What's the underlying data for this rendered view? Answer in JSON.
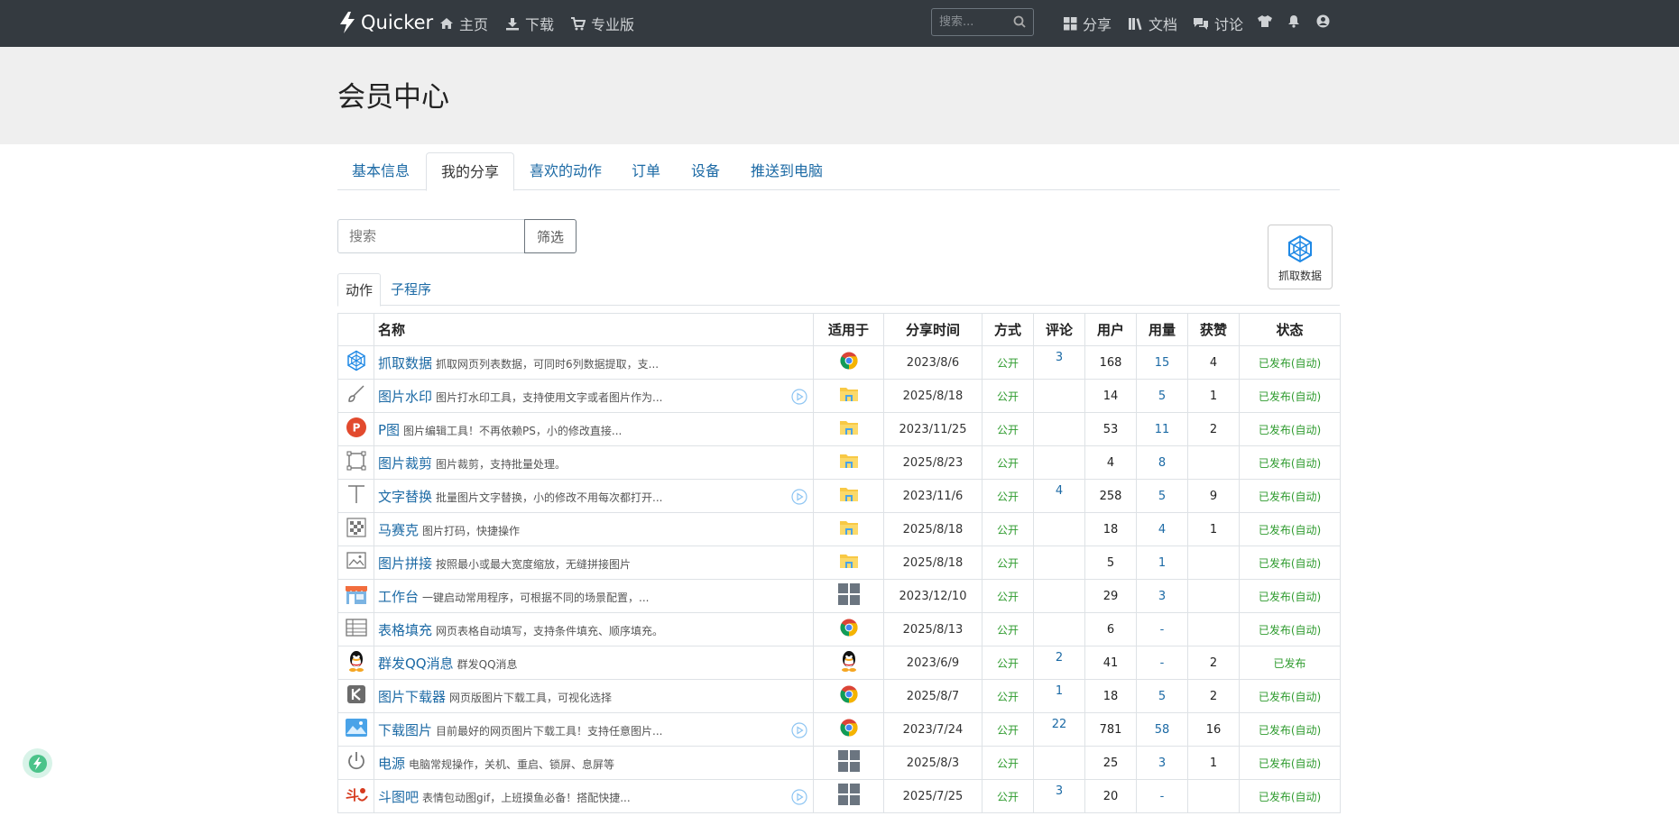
{
  "nav": {
    "brand": "Quicker",
    "links": [
      {
        "label": "主页",
        "icon": "home-icon"
      },
      {
        "label": "下载",
        "icon": "download-icon"
      },
      {
        "label": "专业版",
        "icon": "cart-icon"
      }
    ],
    "search_placeholder": "搜索...",
    "right_links": [
      {
        "label": "分享",
        "icon": "grid-icon"
      },
      {
        "label": "文档",
        "icon": "books-icon"
      },
      {
        "label": "讨论",
        "icon": "comments-icon"
      }
    ]
  },
  "page": {
    "title": "会员中心"
  },
  "tabs": [
    {
      "label": "基本信息",
      "active": false
    },
    {
      "label": "我的分享",
      "active": true
    },
    {
      "label": "喜欢的动作",
      "active": false
    },
    {
      "label": "订单",
      "active": false
    },
    {
      "label": "设备",
      "active": false
    },
    {
      "label": "推送到电脑",
      "active": false
    }
  ],
  "filter": {
    "placeholder": "搜索",
    "button": "筛选"
  },
  "grab_button": {
    "label": "抓取数据"
  },
  "subtabs": [
    {
      "label": "动作",
      "active": true
    },
    {
      "label": "子程序",
      "active": false
    }
  ],
  "table": {
    "headers": [
      "名称",
      "适用于",
      "分享时间",
      "方式",
      "评论",
      "用户",
      "用量",
      "获赞",
      "状态"
    ],
    "rows": [
      {
        "icon": "web-scrape-icon",
        "name": "抓取数据",
        "desc": "抓取网页列表数据，可同时6列数据提取，支...",
        "video": false,
        "app": "chrome",
        "date": "2023/8/6",
        "mode": "公开",
        "comments": "3",
        "users": "168",
        "usage": "15",
        "likes": "4",
        "status": "已发布(自动)"
      },
      {
        "icon": "brush-icon",
        "name": "图片水印",
        "desc": "图片打水印工具，支持使用文字或者图片作为...",
        "video": true,
        "app": "explorer",
        "date": "2025/8/18",
        "mode": "公开",
        "comments": "",
        "users": "14",
        "usage": "5",
        "likes": "1",
        "status": "已发布(自动)"
      },
      {
        "icon": "p-circle-icon",
        "name": "P图",
        "desc": "图片编辑工具！不再依赖PS，小的修改直接...",
        "video": false,
        "app": "explorer",
        "date": "2023/11/25",
        "mode": "公开",
        "comments": "",
        "users": "53",
        "usage": "11",
        "likes": "2",
        "status": "已发布(自动)"
      },
      {
        "icon": "crop-icon",
        "name": "图片裁剪",
        "desc": "图片裁剪，支持批量处理。",
        "video": false,
        "app": "explorer",
        "date": "2025/8/23",
        "mode": "公开",
        "comments": "",
        "users": "4",
        "usage": "8",
        "likes": "",
        "status": "已发布(自动)"
      },
      {
        "icon": "text-icon",
        "name": "文字替换",
        "desc": "批量图片文字替换，小的修改不用每次都打开...",
        "video": true,
        "app": "explorer",
        "date": "2023/11/6",
        "mode": "公开",
        "comments": "4",
        "users": "258",
        "usage": "5",
        "likes": "9",
        "status": "已发布(自动)"
      },
      {
        "icon": "mosaic-icon",
        "name": "马赛克",
        "desc": "图片打码，快捷操作",
        "video": false,
        "app": "explorer",
        "date": "2025/8/18",
        "mode": "公开",
        "comments": "",
        "users": "18",
        "usage": "4",
        "likes": "1",
        "status": "已发布(自动)"
      },
      {
        "icon": "image-icon",
        "name": "图片拼接",
        "desc": "按照最小或最大宽度缩放，无缝拼接图片",
        "video": false,
        "app": "explorer",
        "date": "2025/8/18",
        "mode": "公开",
        "comments": "",
        "users": "5",
        "usage": "1",
        "likes": "",
        "status": "已发布(自动)"
      },
      {
        "icon": "shop-icon",
        "name": "工作台",
        "desc": "一键启动常用程序，可根据不同的场景配置，...",
        "video": false,
        "app": "windows",
        "date": "2023/12/10",
        "mode": "公开",
        "comments": "",
        "users": "29",
        "usage": "3",
        "likes": "",
        "status": "已发布(自动)"
      },
      {
        "icon": "table-icon",
        "name": "表格填充",
        "desc": "网页表格自动填写，支持条件填充、顺序填充。",
        "video": false,
        "app": "chrome",
        "date": "2025/8/13",
        "mode": "公开",
        "comments": "",
        "users": "6",
        "usage": "-",
        "likes": "",
        "status": "已发布(自动)"
      },
      {
        "icon": "qq-icon",
        "name": "群发QQ消息",
        "desc": "群发QQ消息",
        "video": false,
        "app": "qq",
        "date": "2023/6/9",
        "mode": "公开",
        "comments": "2",
        "users": "41",
        "usage": "-",
        "likes": "2",
        "status": "已发布"
      },
      {
        "icon": "k-icon",
        "name": "图片下载器",
        "desc": "网页版图片下载工具，可视化选择",
        "video": false,
        "app": "chrome",
        "date": "2025/8/7",
        "mode": "公开",
        "comments": "1",
        "users": "18",
        "usage": "5",
        "likes": "2",
        "status": "已发布(自动)"
      },
      {
        "icon": "picture-icon",
        "name": "下载图片",
        "desc": "目前最好的网页图片下载工具！支持任意图片...",
        "video": true,
        "app": "chrome",
        "date": "2023/7/24",
        "mode": "公开",
        "comments": "22",
        "users": "781",
        "usage": "58",
        "likes": "16",
        "status": "已发布(自动)"
      },
      {
        "icon": "power-icon",
        "name": "电源",
        "desc": "电脑常规操作，关机、重启、锁屏、息屏等",
        "video": false,
        "app": "windows",
        "date": "2025/8/3",
        "mode": "公开",
        "comments": "",
        "users": "25",
        "usage": "3",
        "likes": "1",
        "status": "已发布(自动)"
      },
      {
        "icon": "doutu-icon",
        "name": "斗图吧",
        "desc": "表情包动图gif，上班摸鱼必备！搭配快捷...",
        "video": true,
        "app": "windows",
        "date": "2025/7/25",
        "mode": "公开",
        "comments": "3",
        "users": "20",
        "usage": "-",
        "likes": "",
        "status": "已发布(自动)"
      }
    ]
  },
  "colors": {
    "nav_bg": "#343a40",
    "link": "#1c6aa5",
    "published": "#2e9b2e",
    "hero_bg": "#efefef"
  }
}
